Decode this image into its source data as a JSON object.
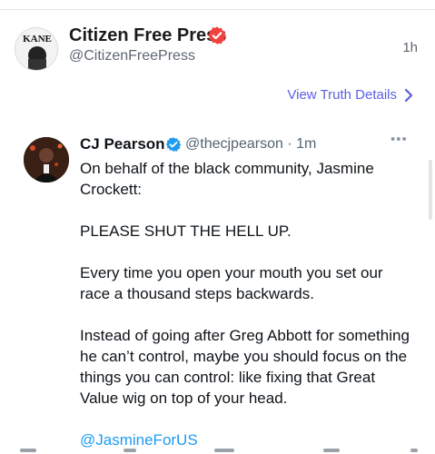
{
  "post": {
    "author_name": "Citizen Free Press",
    "author_handle": "@CitizenFreePress",
    "timestamp": "1h",
    "avatar_text": "KANE",
    "view_details_label": "View Truth Details"
  },
  "embedded": {
    "author_name": "CJ Pearson",
    "handle_time": "@thecjpearson · 1m",
    "more_label": "•••",
    "paragraphs": [
      "On behalf of the black community, Jasmine Crockett:",
      "PLEASE SHUT THE HELL UP.",
      "Every time you open your mouth you set our race a thousand steps backwards.",
      "Instead of going after Greg Abbott for something he can’t control, maybe you should focus on the things you can control: like fixing that Great Value wig on top of your head."
    ],
    "mention": "@JasmineForUS"
  },
  "colors": {
    "verified_red": "#f0413c",
    "verified_blue": "#1d9bf0",
    "link": "#5b5fe3",
    "mention": "#1d9bf0"
  },
  "icons": {
    "verified_badge_red": "verified-badge-icon",
    "verified_badge_blue": "verified-badge-icon",
    "chevron": "chevron-right-icon",
    "more": "more-dots-icon"
  }
}
